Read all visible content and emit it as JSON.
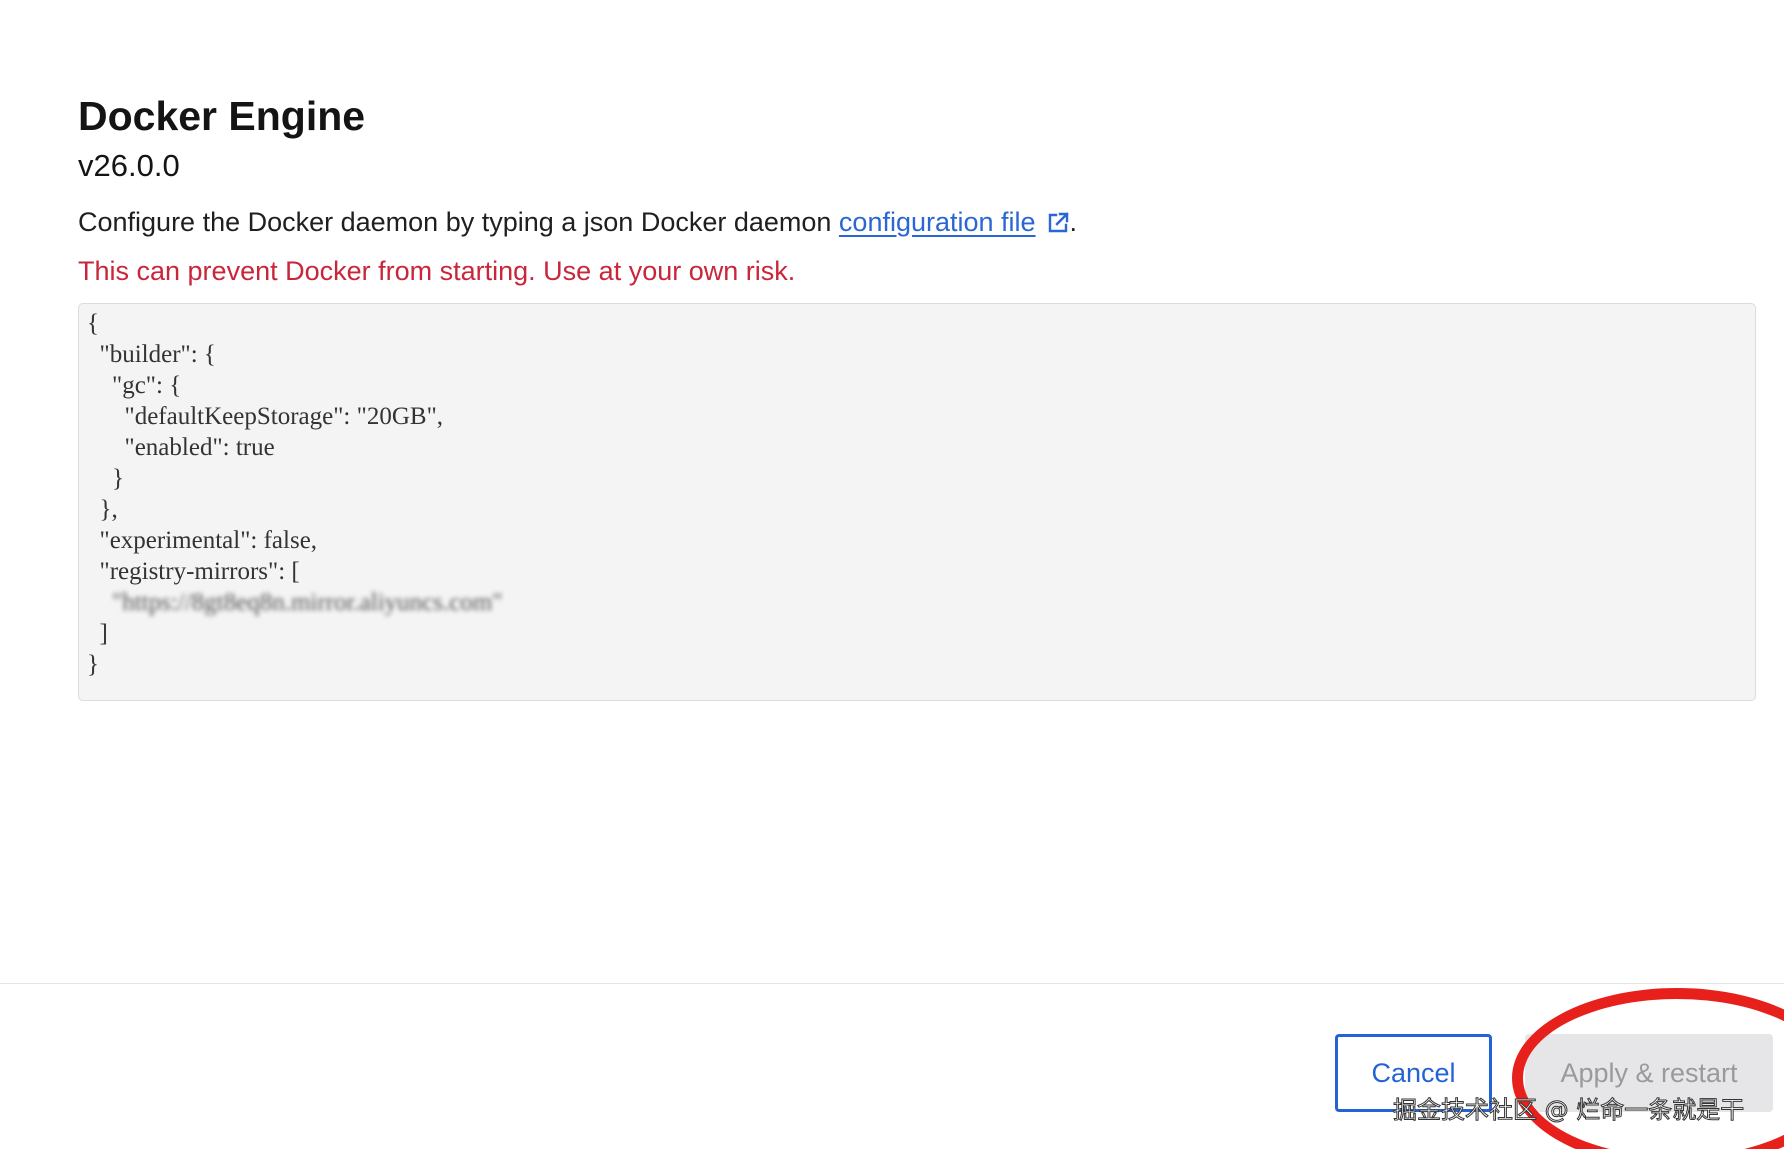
{
  "header": {
    "title": "Docker Engine",
    "version": "v26.0.0"
  },
  "description": {
    "text_before_link": "Configure the Docker daemon by typing a json Docker daemon ",
    "link_label": "configuration file",
    "link_icon": "external-link-icon",
    "text_after_link": "."
  },
  "warning": {
    "text": "This can prevent Docker from starting. Use at your own risk."
  },
  "editor": {
    "lines": [
      "{",
      "  \"builder\": {",
      "    \"gc\": {",
      "      \"defaultKeepStorage\": \"20GB\",",
      "      \"enabled\": true",
      "    }",
      "  },",
      "  \"experimental\": false,",
      "  \"registry-mirrors\": [",
      "    \"https://8gt8eq8n.mirror.aliyuncs.com\"",
      "  ]",
      "}"
    ]
  },
  "footer": {
    "cancel_label": "Cancel",
    "apply_label": "Apply & restart"
  },
  "annotation": {
    "ring_color": "#e8201c"
  },
  "watermark": {
    "text": "掘金技术社区 @ 烂命一条就是干"
  },
  "colors": {
    "link": "#2a66d4",
    "warning": "#c9263b",
    "primary": "#2363d6",
    "disabled_bg": "#e6e6e8",
    "disabled_text": "#9a9a9e"
  }
}
